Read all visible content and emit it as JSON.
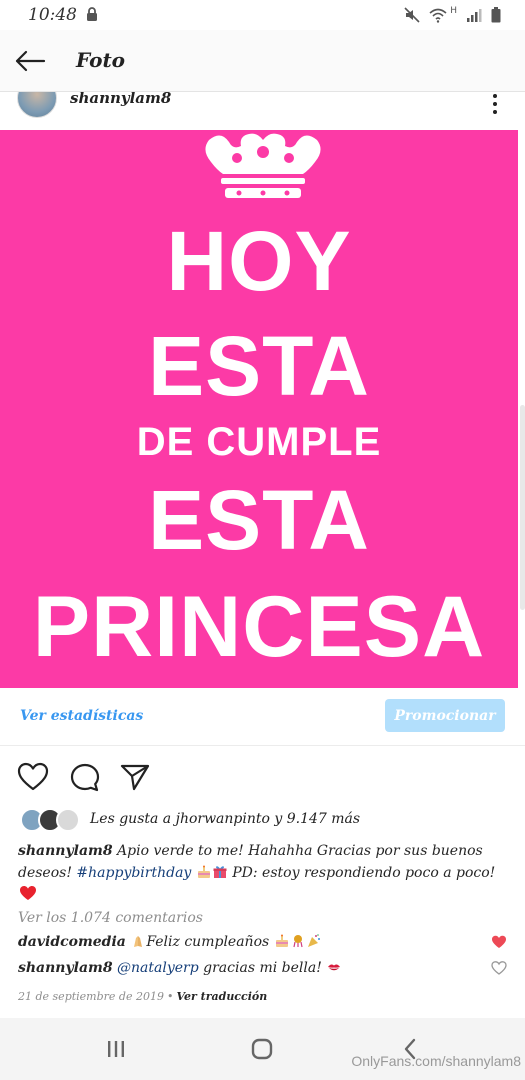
{
  "status_bar": {
    "time": "10:48",
    "network": "H",
    "icons": [
      "lock-icon",
      "mute-icon",
      "wifi-icon",
      "signal-icon",
      "battery-icon"
    ]
  },
  "app_bar": {
    "title": "Foto",
    "back_icon": "arrow-left-icon"
  },
  "post": {
    "username": "shannylam8",
    "image_text": {
      "line1": "HOY",
      "line2": "ESTA",
      "line3": "DE CUMPLE",
      "line4": "ESTA",
      "line5": "PRINCESA"
    },
    "image_bg_color": "#fc3aa6",
    "stats_link": "Ver estadísticas",
    "promote_label": "Promocionar",
    "likes_text": "Les gusta a jhorwanpinto y 9.147 más",
    "caption": {
      "username": "shannylam8",
      "text1": "Apio verde to me! Hahahha Gracias por sus buenos deseos!",
      "hashtag": "#happybirthday",
      "text2": "PD: estoy respondiendo poco a poco!"
    },
    "view_comments": "Ver los 1.074 comentarios",
    "comments": [
      {
        "user": "davidcomedia",
        "text": "Feliz cumpleaños",
        "liked": true
      },
      {
        "user": "shannylam8",
        "mention": "@natalyerp",
        "text": "gracias mi bella!",
        "liked": false
      }
    ],
    "date": "21 de septiembre de 2019",
    "separator": "•",
    "translate_link": "Ver traducción"
  },
  "colors": {
    "accent": "#3897f0",
    "promote": "#b2dffc",
    "heart_red": "#ed4956",
    "hashtag": "#163f79"
  },
  "watermark": "OnlyFans.com/shannylam8"
}
